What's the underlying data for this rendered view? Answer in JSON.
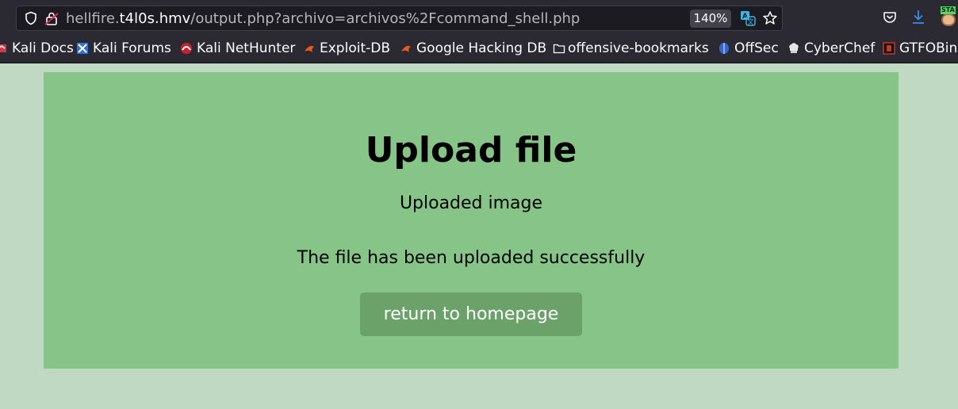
{
  "browser": {
    "url_host_prefix": "hellfire.",
    "url_host": "t4l0s.hmv",
    "url_path": "/output.php?archivo=archivos%2Fcommand_shell.php",
    "zoom": "140%",
    "extension_tag": "STA"
  },
  "bookmarks": [
    {
      "label": "Kali Docs",
      "icon": "kali-docs-icon"
    },
    {
      "label": "Kali Forums",
      "icon": "kali-forums-icon"
    },
    {
      "label": "Kali NetHunter",
      "icon": "nethunter-icon"
    },
    {
      "label": "Exploit-DB",
      "icon": "exploit-db-icon"
    },
    {
      "label": "Google Hacking DB",
      "icon": "ghdb-icon"
    },
    {
      "label": "offensive-bookmarks",
      "icon": "folder-icon"
    },
    {
      "label": "OffSec",
      "icon": "offsec-icon"
    },
    {
      "label": "CyberChef",
      "icon": "cyberchef-icon"
    },
    {
      "label": "GTFOBins",
      "icon": "gtfobins-icon"
    }
  ],
  "page": {
    "title": "Upload file",
    "uploaded_label": "Uploaded image",
    "message": "The file has been uploaded successfully",
    "home_button": "return to homepage"
  },
  "colors": {
    "page_background": "#c0d9c2",
    "card_background": "#86c587",
    "button_background": "#6aa26a",
    "chrome_background": "#2b2a33"
  }
}
